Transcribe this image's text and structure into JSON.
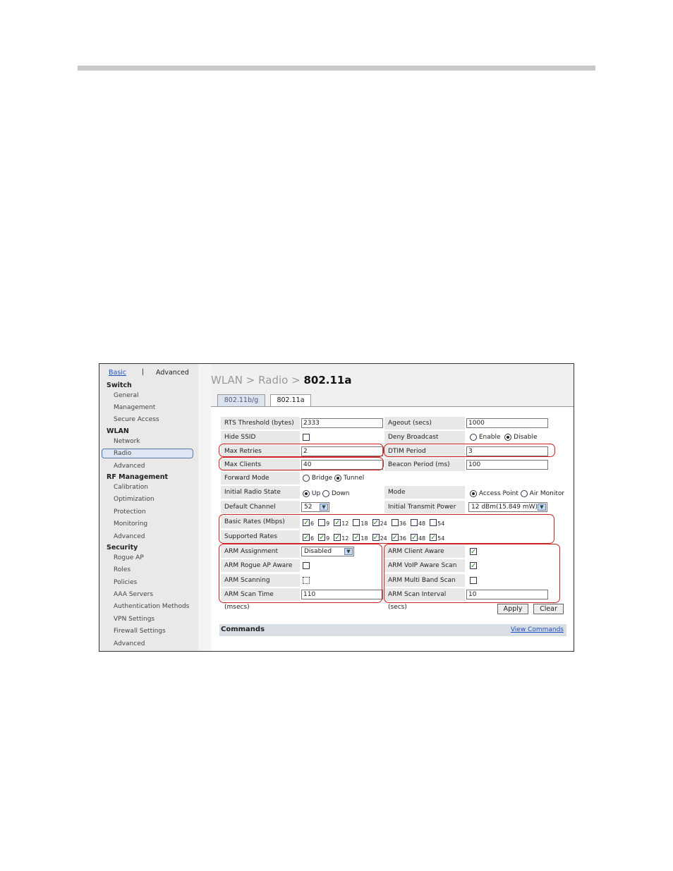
{
  "sidebar": {
    "tab_basic": "Basic",
    "tab_sep": "|",
    "tab_advanced": "Advanced",
    "sections": [
      {
        "title": "Switch",
        "items": [
          "General",
          "Management",
          "Secure Access"
        ]
      },
      {
        "title": "WLAN",
        "items": [
          "Network",
          "Radio",
          "Advanced"
        ]
      },
      {
        "title": "RF Management",
        "items": [
          "Calibration",
          "Optimization",
          "Protection",
          "Monitoring",
          "Advanced"
        ]
      },
      {
        "title": "Security",
        "items": [
          "Rogue AP",
          "Roles",
          "Policies",
          "AAA Servers",
          "Authentication Methods",
          "VPN Settings",
          "Firewall Settings",
          "Advanced"
        ]
      }
    ],
    "selected": "Radio"
  },
  "header": {
    "crumb1": "WLAN",
    "crumb2": "Radio",
    "crumb3": "802.11a",
    "sep": ">"
  },
  "tabs": [
    "802.11b/g",
    "802.11a"
  ],
  "form": {
    "rts_label": "RTS Threshold (bytes)",
    "rts_value": "2333",
    "ageout_label": "Ageout (secs)",
    "ageout_value": "1000",
    "hide_ssid_label": "Hide SSID",
    "deny_bc_label": "Deny Broadcast",
    "deny_enable": "Enable",
    "deny_disable": "Disable",
    "max_retries_label": "Max Retries",
    "max_retries_value": "2",
    "dtim_label": "DTIM Period",
    "dtim_value": "3",
    "max_clients_label": "Max Clients",
    "max_clients_value": "40",
    "beacon_label": "Beacon Period (ms)",
    "beacon_value": "100",
    "fwd_label": "Forward Mode",
    "fwd_bridge": "Bridge",
    "fwd_tunnel": "Tunnel",
    "init_radio_label": "Initial Radio State",
    "init_up": "Up",
    "init_down": "Down",
    "mode_label": "Mode",
    "mode_ap": "Access Point",
    "mode_am": "Air Monitor",
    "channel_label": "Default Channel",
    "channel_value": "52",
    "power_label": "Initial Transmit Power",
    "power_value": "12 dBm(15.849 mW)",
    "basic_rates_label": "Basic Rates (Mbps)",
    "supported_rates_label": "Supported Rates (Mbps)",
    "rates": [
      "6",
      "9",
      "12",
      "18",
      "24",
      "36",
      "48",
      "54"
    ],
    "basic_rates_checked": [
      true,
      false,
      true,
      false,
      true,
      false,
      false,
      false
    ],
    "supported_rates_checked": [
      true,
      true,
      true,
      true,
      true,
      true,
      true,
      true
    ],
    "arm_assign_label": "ARM Assignment",
    "arm_assign_value": "Disabled",
    "arm_client_label": "ARM Client Aware",
    "arm_rogue_label": "ARM Rogue AP Aware",
    "arm_voip_label": "ARM VoIP Aware Scan",
    "arm_scanning_label": "ARM Scanning",
    "arm_multiband_label": "ARM Multi Band Scan",
    "arm_scantime_label": "ARM Scan Time (msecs)",
    "arm_scantime_value": "110",
    "arm_interval_label": "ARM Scan Interval (secs)",
    "arm_interval_value": "10"
  },
  "buttons": {
    "apply": "Apply",
    "clear": "Clear"
  },
  "commands": {
    "title": "Commands",
    "link": "View Commands"
  }
}
